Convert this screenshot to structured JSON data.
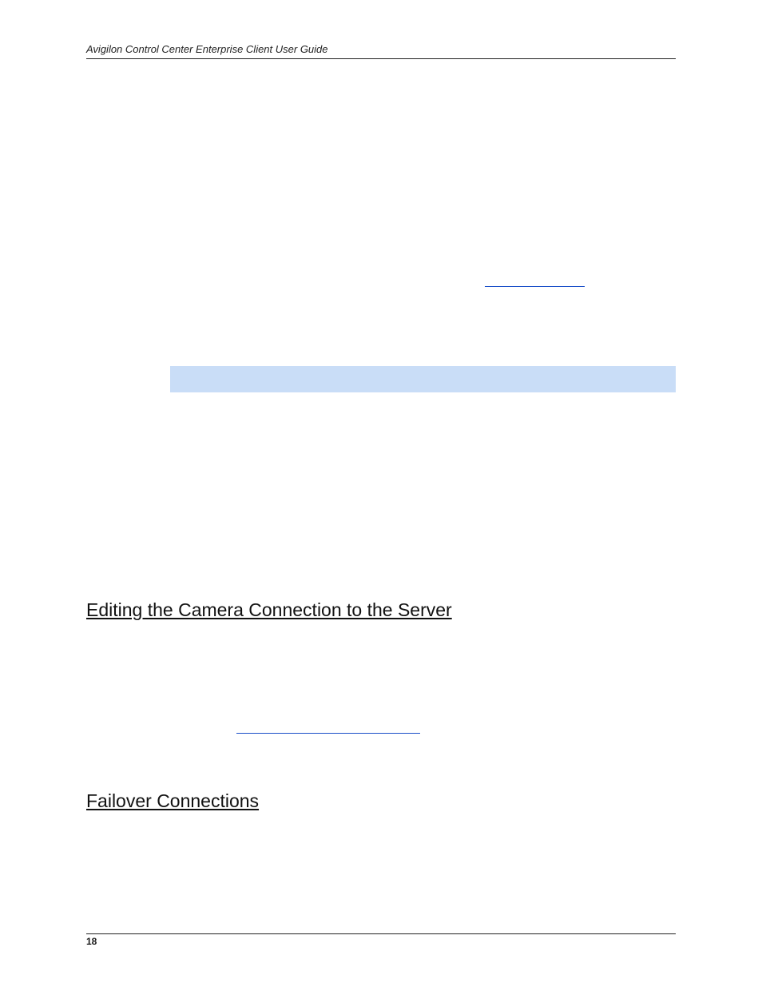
{
  "header": {
    "running_title": "Avigilon Control Center Enterprise Client User Guide"
  },
  "links": {
    "crossref_1_visible_text": "",
    "crossref_2_visible_text": ""
  },
  "headings": {
    "h1": "Editing the Camera Connection to the Server",
    "h2": "Failover Connections"
  },
  "footer": {
    "page_number": "18"
  }
}
